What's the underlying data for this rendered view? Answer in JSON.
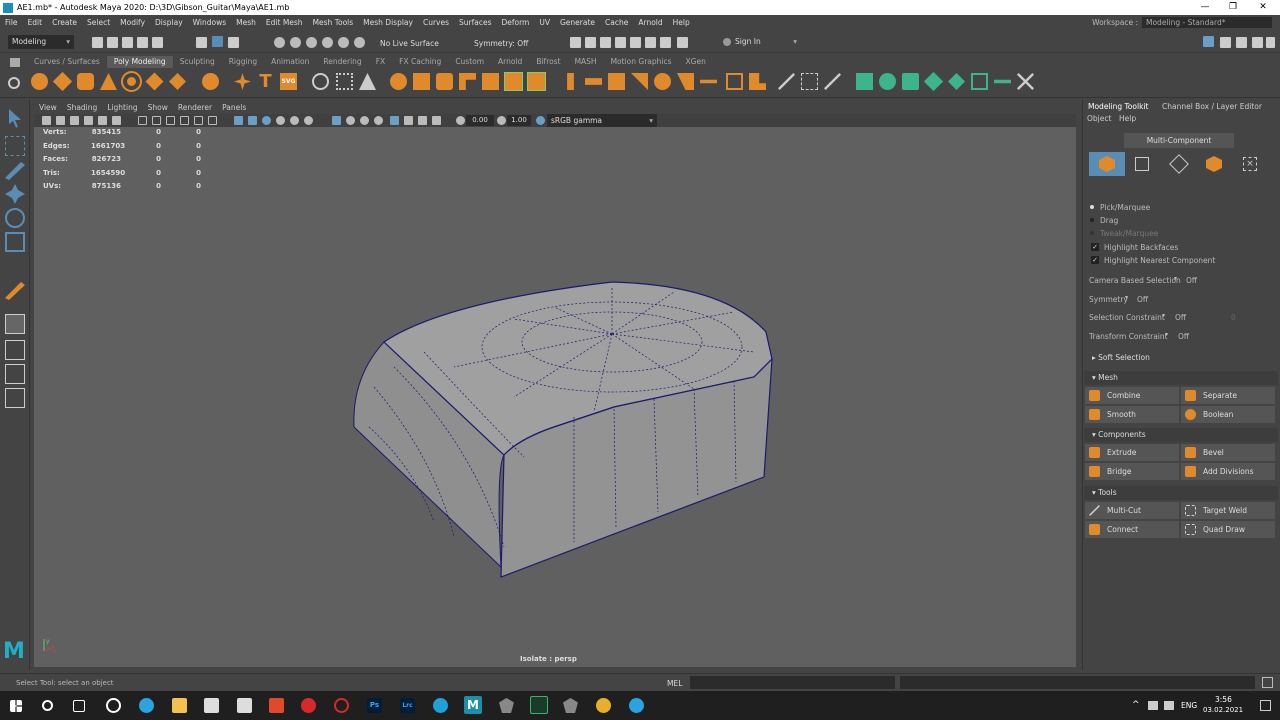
{
  "window": {
    "title": "AE1.mb* - Autodesk Maya 2020: D:\\3D\\Gibson_Guitar\\Maya\\AE1.mb",
    "controls": [
      "—",
      "❐",
      "✕"
    ]
  },
  "menubar": {
    "items": [
      "File",
      "Edit",
      "Create",
      "Select",
      "Modify",
      "Display",
      "Windows",
      "Mesh",
      "Edit Mesh",
      "Mesh Tools",
      "Mesh Display",
      "Curves",
      "Surfaces",
      "Deform",
      "UV",
      "Generate",
      "Cache",
      "Arnold",
      "Help"
    ],
    "workspace_label": "Workspace :",
    "workspace_value": "Modeling - Standard*"
  },
  "statusline": {
    "mode": "Modeling",
    "live_surface": "No Live Surface",
    "symmetry": "Symmetry: Off",
    "sign_in": "Sign In"
  },
  "shelf": {
    "tabs": [
      "Curves / Surfaces",
      "Poly Modeling",
      "Sculpting",
      "Rigging",
      "Animation",
      "Rendering",
      "FX",
      "FX Caching",
      "Custom",
      "Arnold",
      "Bifrost",
      "MASH",
      "Motion Graphics",
      "XGen"
    ],
    "active_tab": "Poly Modeling",
    "text_tool_glyph": "T",
    "svg_tool_glyph": "SVG"
  },
  "viewport": {
    "menu": [
      "View",
      "Shading",
      "Lighting",
      "Show",
      "Renderer",
      "Panels"
    ],
    "exposure": "0.00",
    "gamma": "1.00",
    "color_space": "sRGB gamma",
    "hud": [
      {
        "label": "Verts:",
        "value": "835415",
        "a": "0",
        "b": "0"
      },
      {
        "label": "Edges:",
        "value": "1661703",
        "a": "0",
        "b": "0"
      },
      {
        "label": "Faces:",
        "value": "826723",
        "a": "0",
        "b": "0"
      },
      {
        "label": "Tris:",
        "value": "1654590",
        "a": "0",
        "b": "0"
      },
      {
        "label": "UVs:",
        "value": "875136",
        "a": "0",
        "b": "0"
      }
    ],
    "camera_label": "Isolate : persp",
    "axis_y": "y",
    "axis_x": "x",
    "colors": {
      "background": "#606060",
      "mesh": "#9a9a9a",
      "wire": "#1a1a6e"
    }
  },
  "right_panel": {
    "tabs": [
      "Modeling Toolkit",
      "Channel Box / Layer Editor"
    ],
    "submenu": [
      "Object",
      "Help"
    ],
    "multi_component": "Multi-Component",
    "pick_options": [
      "Pick/Marquee",
      "Drag",
      "Tweak/Marquee"
    ],
    "checks": [
      "Highlight Backfaces",
      "Highlight Nearest Component"
    ],
    "camera_based_selection": {
      "label": "Camera Based Selection",
      "value": "Off"
    },
    "symmetry": {
      "label": "Symmetry",
      "value": "Off"
    },
    "selection_constraint": {
      "label": "Selection Constraint",
      "value": "Off",
      "extra": "0"
    },
    "transform_constraint": {
      "label": "Transform Constraint",
      "value": "Off"
    },
    "soft_selection": "Soft Selection",
    "sections": {
      "mesh": {
        "title": "Mesh",
        "buttons": [
          "Combine",
          "Separate",
          "Smooth",
          "Boolean"
        ]
      },
      "components": {
        "title": "Components",
        "buttons": [
          "Extrude",
          "Bevel",
          "Bridge",
          "Add Divisions"
        ]
      },
      "tools": {
        "title": "Tools",
        "buttons": [
          "Multi-Cut",
          "Target Weld",
          "Connect",
          "Quad Draw"
        ]
      }
    }
  },
  "helpline": {
    "text": "Select Tool: select an object",
    "mel_label": "MEL"
  },
  "taskbar": {
    "lang": "ENG",
    "time": "3:56",
    "date": "03.02.2021",
    "app_labels": [
      "Ps",
      "Lrc",
      "M"
    ]
  }
}
